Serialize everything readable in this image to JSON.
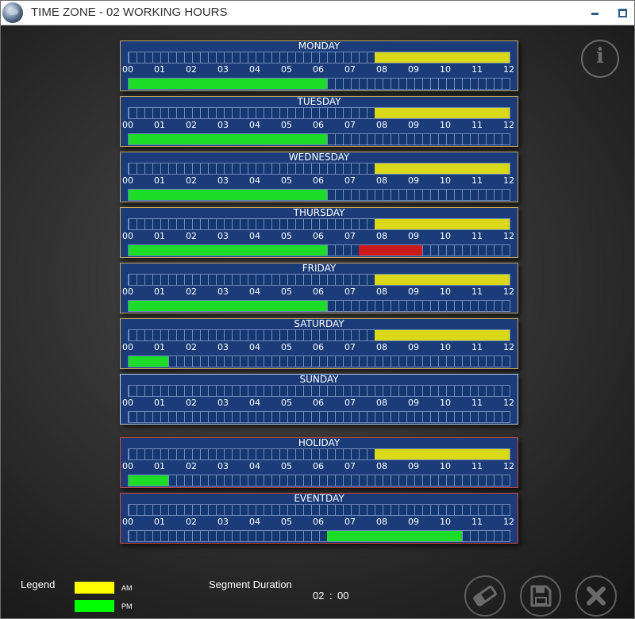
{
  "window": {
    "title": "TIME ZONE - 02 WORKING HOURS"
  },
  "ticks": [
    "00",
    "01",
    "02",
    "03",
    "04",
    "05",
    "06",
    "07",
    "08",
    "09",
    "10",
    "11",
    "12"
  ],
  "schedule": [
    {
      "label": "MONDAY",
      "am": [
        {
          "start": 7.75,
          "end": 12,
          "color": "#d9d91a"
        }
      ],
      "pm": [
        {
          "start": 0,
          "end": 6.25,
          "color": "#1ddc28"
        }
      ],
      "border": "gold"
    },
    {
      "label": "TUESDAY",
      "am": [
        {
          "start": 7.75,
          "end": 12,
          "color": "#d9d91a"
        }
      ],
      "pm": [
        {
          "start": 0,
          "end": 6.25,
          "color": "#1ddc28"
        }
      ],
      "border": "gold"
    },
    {
      "label": "WEDNESDAY",
      "am": [
        {
          "start": 7.75,
          "end": 12,
          "color": "#d9d91a"
        }
      ],
      "pm": [
        {
          "start": 0,
          "end": 6.25,
          "color": "#1ddc28"
        }
      ],
      "border": "gold"
    },
    {
      "label": "THURSDAY",
      "am": [
        {
          "start": 7.75,
          "end": 12,
          "color": "#d9d91a"
        }
      ],
      "pm": [
        {
          "start": 0,
          "end": 6.25,
          "color": "#1ddc28"
        },
        {
          "start": 7.25,
          "end": 9.25,
          "color": "#cc1a1a"
        }
      ],
      "border": "gold"
    },
    {
      "label": "FRIDAY",
      "am": [
        {
          "start": 7.75,
          "end": 12,
          "color": "#d9d91a"
        }
      ],
      "pm": [
        {
          "start": 0,
          "end": 6.25,
          "color": "#1ddc28"
        }
      ],
      "border": "gold"
    },
    {
      "label": "SATURDAY",
      "am": [
        {
          "start": 7.75,
          "end": 12,
          "color": "#d9d91a"
        }
      ],
      "pm": [
        {
          "start": 0,
          "end": 1.25,
          "color": "#1ddc28"
        }
      ],
      "border": "gold"
    },
    {
      "label": "SUNDAY",
      "am": [],
      "pm": [],
      "border": "silver"
    },
    {
      "label": "HOLIDAY",
      "am": [
        {
          "start": 7.75,
          "end": 12,
          "color": "#d9d91a"
        }
      ],
      "pm": [
        {
          "start": 0,
          "end": 1.25,
          "color": "#1ddc28"
        }
      ],
      "border": "red"
    },
    {
      "label": "EVENTDAY",
      "am": [],
      "pm": [
        {
          "start": 6.25,
          "end": 10.5,
          "color": "#1ddc28"
        }
      ],
      "border": "red"
    }
  ],
  "legend": {
    "title": "Legend",
    "am_label": "AM",
    "pm_label": "PM",
    "am_color": "#ffff00",
    "pm_color": "#00ff00"
  },
  "segment": {
    "title": "Segment Duration",
    "hours": "02",
    "separator": ":",
    "minutes": "00"
  },
  "icons": {
    "info": "info-icon",
    "erase": "eraser-icon",
    "save": "floppy-disk-icon",
    "close": "close-icon",
    "minimize": "minimize-icon",
    "maximize": "maximize-icon"
  }
}
